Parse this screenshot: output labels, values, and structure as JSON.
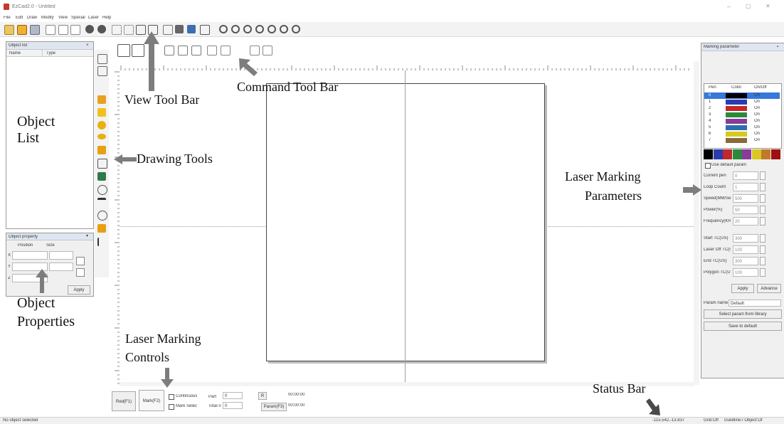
{
  "window": {
    "title": "EzCad2.0 - Untitled",
    "controls": [
      "–",
      "▢",
      "✕"
    ]
  },
  "menu": [
    "File",
    "Edit",
    "Draw",
    "Modify",
    "View",
    "Special",
    "Laser",
    "Help"
  ],
  "object_list": {
    "header": "Object list",
    "columns": [
      "Name",
      "Type"
    ]
  },
  "object_properties": {
    "header": "Object property",
    "col_position": "Position",
    "col_size": "Size",
    "labels": [
      "X",
      "Y",
      "Z"
    ],
    "apply": "Apply"
  },
  "marking_params": {
    "header": "Marking parameter",
    "columns": [
      "Pen",
      "Color",
      "On/Off"
    ],
    "pens": [
      {
        "n": "0",
        "color": "#000000",
        "state": "On"
      },
      {
        "n": "1",
        "color": "#2b3bb0",
        "state": "On"
      },
      {
        "n": "2",
        "color": "#c0282a",
        "state": "On"
      },
      {
        "n": "3",
        "color": "#2a8a3a",
        "state": "On"
      },
      {
        "n": "4",
        "color": "#8a3a9a",
        "state": "On"
      },
      {
        "n": "5",
        "color": "#2b6fb0",
        "state": "On"
      },
      {
        "n": "6",
        "color": "#d8c820",
        "state": "On"
      },
      {
        "n": "7",
        "color": "#8a6a3a",
        "state": "On"
      }
    ],
    "palette": [
      "#000000",
      "#2b3bb0",
      "#c0282a",
      "#2a8a3a",
      "#8a3a9a",
      "#d8c820",
      "#c07a2a",
      "#a01010"
    ],
    "use_default": "Use default param",
    "rows": [
      {
        "label": "Current pen",
        "value": "0"
      },
      {
        "label": "Loop Count",
        "value": "1"
      },
      {
        "label": "Speed(MM/Second)",
        "value": "500"
      },
      {
        "label": "Power(%)",
        "value": "50"
      },
      {
        "label": "Frequency(KHz)",
        "value": "20"
      }
    ],
    "rows2": [
      {
        "label": "Start TC(US)",
        "value": "300"
      },
      {
        "label": "Laser Off TC(US)",
        "value": "100"
      },
      {
        "label": "End TC(US)",
        "value": "300"
      },
      {
        "label": "Polygon TC(US)",
        "value": "100"
      }
    ],
    "btn_adv": "Advance",
    "btn_apply": "Apply",
    "param_name_label": "Param name",
    "param_name_value": "Default",
    "btn_select": "Select param from library",
    "btn_save": "Save to default"
  },
  "bottom_controls": {
    "red": "Red(F1)",
    "mark": "Mark(F2)",
    "continuous": "Continuous",
    "part_label": "Part",
    "part_value": "0",
    "r_btn": "R",
    "mark_select": "Mark Selec",
    "total_label": "Total n",
    "total_value": "0",
    "time1": "00:00:00",
    "param_btn": "Param(F3)",
    "time2": "00:00:00"
  },
  "status": {
    "left": "No object selected",
    "coords": "-115.542,-13.837",
    "snap": "Grid:Off",
    "guide": "Guildline:/ Object:Of"
  },
  "annotations": {
    "view_toolbar": "View Tool Bar",
    "command_toolbar": "Command Tool Bar",
    "object_list": [
      "Object",
      "List"
    ],
    "drawing_tools": "Drawing Tools",
    "laser_params": [
      "Laser Marking",
      "Parameters"
    ],
    "object_props": [
      "Object",
      "Properties"
    ],
    "laser_controls": [
      "Laser Marking",
      "Controls"
    ],
    "status_bar": "Status Bar"
  },
  "colors": {
    "chrome": "#f0f0f0",
    "panel_header": "#dfe6ef",
    "arrow": "#808080",
    "selected_pen": "#3878d8"
  }
}
